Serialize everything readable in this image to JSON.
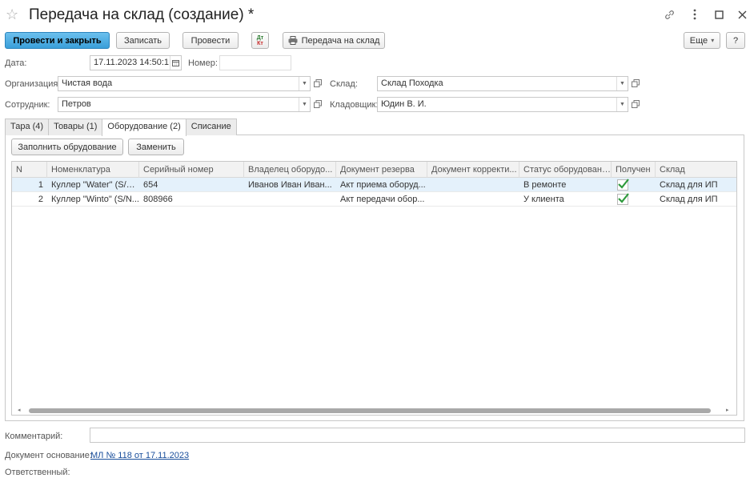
{
  "window": {
    "title": "Передача на склад (создание) *"
  },
  "toolbar": {
    "post_close": "Провести и закрыть",
    "save": "Записать",
    "post": "Провести",
    "dtkt_top": "Дт",
    "dtkt_bottom": "Кт",
    "transfer": "Передача на склад",
    "more": "Еще",
    "more_arrow": "▾",
    "help": "?"
  },
  "form": {
    "date_label": "Дата:",
    "date_value": "17.11.2023 14:50:1",
    "number_label": "Номер:",
    "number_value": "",
    "org_label": "Организация:",
    "org_value": "Чистая вода",
    "warehouse_label": "Склад:",
    "warehouse_value": "Склад Походка",
    "employee_label": "Сотрудник:",
    "employee_value": "Петров",
    "storekeeper_label": "Кладовщик:",
    "storekeeper_value": "Юдин В. И."
  },
  "tabs": [
    {
      "label": "Тара (4)"
    },
    {
      "label": "Товары (1)"
    },
    {
      "label": "Оборудование (2)"
    },
    {
      "label": "Списание"
    }
  ],
  "equipment": {
    "fill_button": "Заполнить обрудование",
    "replace_button": "Заменить",
    "columns": [
      "N",
      "Номенклатура",
      "Серийный номер",
      "Владелец оборудо...",
      "Документ резерва",
      "Документ корректи...",
      "Статус оборудования",
      "Получен",
      "Склад"
    ],
    "rows": [
      {
        "n": "1",
        "nomenclature": "Куллер \"Water\" (S/N...",
        "serial": "654",
        "owner": "Иванов Иван Иван...",
        "reserve_doc": "Акт приема оборуд...",
        "correction_doc": "",
        "status": "В ремонте",
        "received": true,
        "warehouse": "Склад для ИП"
      },
      {
        "n": "2",
        "nomenclature": "Куллер \"Winto\" (S/N...",
        "serial": "808966",
        "owner": "",
        "reserve_doc": "Акт передачи обор...",
        "correction_doc": "",
        "status": "У клиента",
        "received": true,
        "warehouse": "Склад для ИП"
      }
    ]
  },
  "footer": {
    "comment_label": "Комментарий:",
    "comment_value": "",
    "basis_label": "Документ основание:",
    "basis_link": "МЛ № 118 от 17.11.2023",
    "responsible_label": "Ответственный:"
  },
  "colors": {
    "primary_button": "#3a9fd9",
    "check": "#2e9a3c",
    "link": "#1a4f9c",
    "selected_row": "#e4f1fb"
  }
}
